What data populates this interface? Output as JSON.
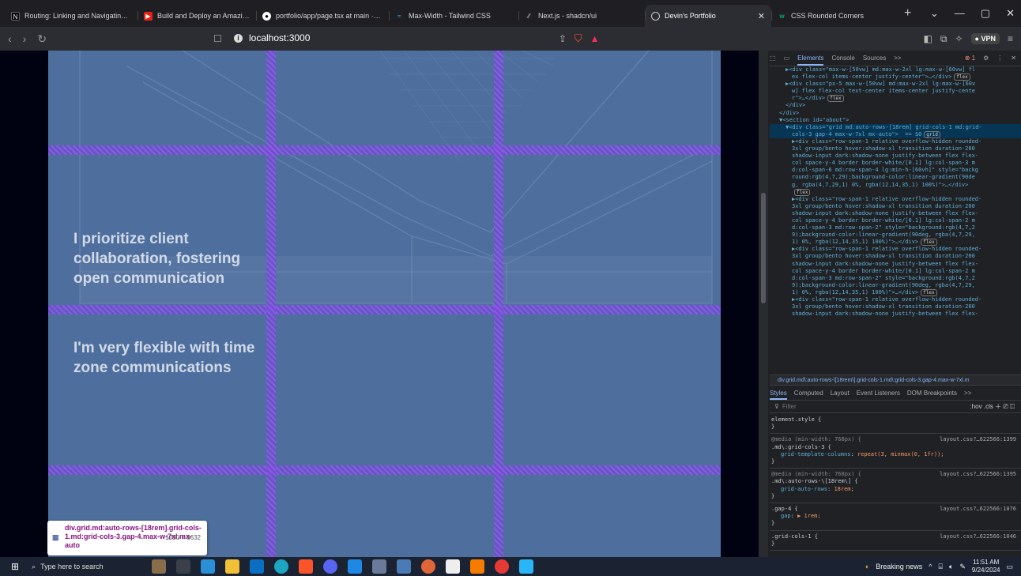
{
  "browser": {
    "tabs": [
      {
        "title": "Routing: Linking and Navigating | N",
        "favicon": "nextjs-icon",
        "active": false
      },
      {
        "title": "Build and Deploy an Amazing Devel",
        "favicon": "youtube-icon",
        "active": false
      },
      {
        "title": "portfolio/app/page.tsx at main · adr",
        "favicon": "github-icon",
        "active": false
      },
      {
        "title": "Max-Width - Tailwind CSS",
        "favicon": "tailwind-icon",
        "active": false
      },
      {
        "title": "Next.js - shadcn/ui",
        "favicon": "shadcn-icon",
        "active": false
      },
      {
        "title": "Devin's Portfolio",
        "favicon": "globe-icon",
        "active": true
      },
      {
        "title": "CSS Rounded Corners",
        "favicon": "w3schools-icon",
        "active": false
      }
    ],
    "url": "localhost:3000",
    "vpn_label": "VPN"
  },
  "page": {
    "text_block_1": "I prioritize client collaboration, fostering open communication",
    "text_block_2": "I'm very flexible with time zone communications",
    "tooltip": {
      "selector": "div.grid.md:auto-rows-[18rem].grid-cols-1.md:grid-cols-3.gap-4.max-w-7xl.mx-auto",
      "size": "1280 × 3632"
    }
  },
  "devtools": {
    "tabs": [
      "Elements",
      "Console",
      "Sources",
      ">>"
    ],
    "error_count": "1",
    "dom_lines": [
      {
        "indent": 2,
        "text": "▶<div class=\"max-w-[50vw] md:max-w-2xl lg:max-w-[60vw] fl"
      },
      {
        "indent": 3,
        "text": "ex flex-col items-center justify-center\">…</div>",
        "badge": "flex"
      },
      {
        "indent": 2,
        "text": "▶<div class=\"px-5 max-w-[50vw] md:max-w-2xl lg:max-w-[60v"
      },
      {
        "indent": 3,
        "text": "w] flex flex-col text-center items-center justify-cente"
      },
      {
        "indent": 3,
        "text": "r\">…</div>",
        "badge": "flex"
      },
      {
        "indent": 2,
        "text": "</div>"
      },
      {
        "indent": 1,
        "text": "</div>"
      },
      {
        "indent": 1,
        "text": "▼<section id=\"about\">"
      },
      {
        "indent": 2,
        "text": "▼<div class=\"grid md:auto-rows-[18rem] grid-cols-1 md:grid-",
        "highlight": true
      },
      {
        "indent": 3,
        "text": "cols-3 gap-4 max-w-7xl mx-auto\">  == $0",
        "badge": "grid",
        "highlight": true
      },
      {
        "indent": 3,
        "text": "▶<div class=\"row-span-1 relative overflow-hidden rounded-"
      },
      {
        "indent": 3,
        "text": "3xl group/bento hover:shadow-xl transition duration-200"
      },
      {
        "indent": 3,
        "text": "shadow-input dark:shadow-none justify-between flex flex-"
      },
      {
        "indent": 3,
        "text": "col space-y-4 border border-white/[0.1] lg:col-span-3 m"
      },
      {
        "indent": 3,
        "text": "d:col-span-6 md:row-span-4 lg:min-h-[60vh]\" style=\"backg"
      },
      {
        "indent": 3,
        "text": "round:rgb(4,7,29);background-color:linear-gradient(90de"
      },
      {
        "indent": 3,
        "text": "g, rgba(4,7,29,1) 0%, rgba(12,14,35,1) 100%)\">…</div>"
      },
      {
        "indent": 3,
        "text": "",
        "badge": "flex"
      },
      {
        "indent": 3,
        "text": "▶<div class=\"row-span-1 relative overflow-hidden rounded-"
      },
      {
        "indent": 3,
        "text": "3xl group/bento hover:shadow-xl transition duration-200"
      },
      {
        "indent": 3,
        "text": "shadow-input dark:shadow-none justify-between flex flex-"
      },
      {
        "indent": 3,
        "text": "col space-y-4 border border-white/[0.1] lg:col-span-2 m"
      },
      {
        "indent": 3,
        "text": "d:col-span-3 md:row-span-2\" style=\"background:rgb(4,7,2"
      },
      {
        "indent": 3,
        "text": "9);background-color:linear-gradient(90deg, rgba(4,7,29,"
      },
      {
        "indent": 3,
        "text": "1) 0%, rgba(12,14,35,1) 100%)\">…</div>",
        "badge": "flex"
      },
      {
        "indent": 3,
        "text": "▶<div class=\"row-span-1 relative overflow-hidden rounded-"
      },
      {
        "indent": 3,
        "text": "3xl group/bento hover:shadow-xl transition duration-200"
      },
      {
        "indent": 3,
        "text": "shadow-input dark:shadow-none justify-between flex flex-"
      },
      {
        "indent": 3,
        "text": "col space-y-4 border border-white/[0.1] lg:col-span-2 m"
      },
      {
        "indent": 3,
        "text": "d:col-span-3 md:row-span-2\" style=\"background:rgb(4,7,2"
      },
      {
        "indent": 3,
        "text": "9);background-color:linear-gradient(90deg, rgba(4,7,29,"
      },
      {
        "indent": 3,
        "text": "1) 0%, rgba(12,14,35,1) 100%)\">…</div>",
        "badge": "flex"
      },
      {
        "indent": 3,
        "text": "▶<div class=\"row-span-1 relative overflow-hidden rounded-"
      },
      {
        "indent": 3,
        "text": "3xl group/bento hover:shadow-xl transition duration-200"
      },
      {
        "indent": 3,
        "text": "shadow-input dark:shadow-none justify-between flex flex-"
      }
    ],
    "breadcrumb": "div.grid.md\\:auto-rows-\\[18rem\\].grid-cols-1.md\\:grid-cols-3.gap-4.max-w-7xl.m",
    "styles_tabs": [
      "Styles",
      "Computed",
      "Layout",
      "Event Listeners",
      "DOM Breakpoints",
      ">>"
    ],
    "filter_placeholder": "Filter",
    "filter_opts": ":hov .cls",
    "css_rules": [
      {
        "media": "",
        "selector": "element.style {",
        "decls": [],
        "src": ""
      },
      {
        "media": "@media (min-width: 768px) {",
        "selector": ".md\\:grid-cols-3 {",
        "decls": [
          {
            "p": "grid-template-columns",
            "v": "repeat(3, minmax(0, 1fr));"
          }
        ],
        "src": "layout.css?…622566:1399"
      },
      {
        "media": "@media (min-width: 768px) {",
        "selector": ".md\\:auto-rows-\\[18rem\\] {",
        "decls": [
          {
            "p": "grid-auto-rows",
            "v": "18rem;"
          }
        ],
        "src": "layout.css?…622566:1395"
      },
      {
        "media": "",
        "selector": ".gap-4 {",
        "decls": [
          {
            "p": "gap",
            "v": "▶ 1rem;"
          }
        ],
        "src": "layout.css?…622566:1076"
      },
      {
        "media": "",
        "selector": ".grid-cols-1 {",
        "decls": [],
        "src": "layout.css?…622566:1046"
      }
    ]
  },
  "taskbar": {
    "search_placeholder": "Type here to search",
    "news": "Breaking news",
    "time": "11:51 AM",
    "date": "9/24/2024"
  },
  "colors": {
    "grid_overlay": "#7846dc",
    "page_bg": "#4e6f9e",
    "devtools_bg": "#202124",
    "taskbar_bg": "#1b2332"
  }
}
